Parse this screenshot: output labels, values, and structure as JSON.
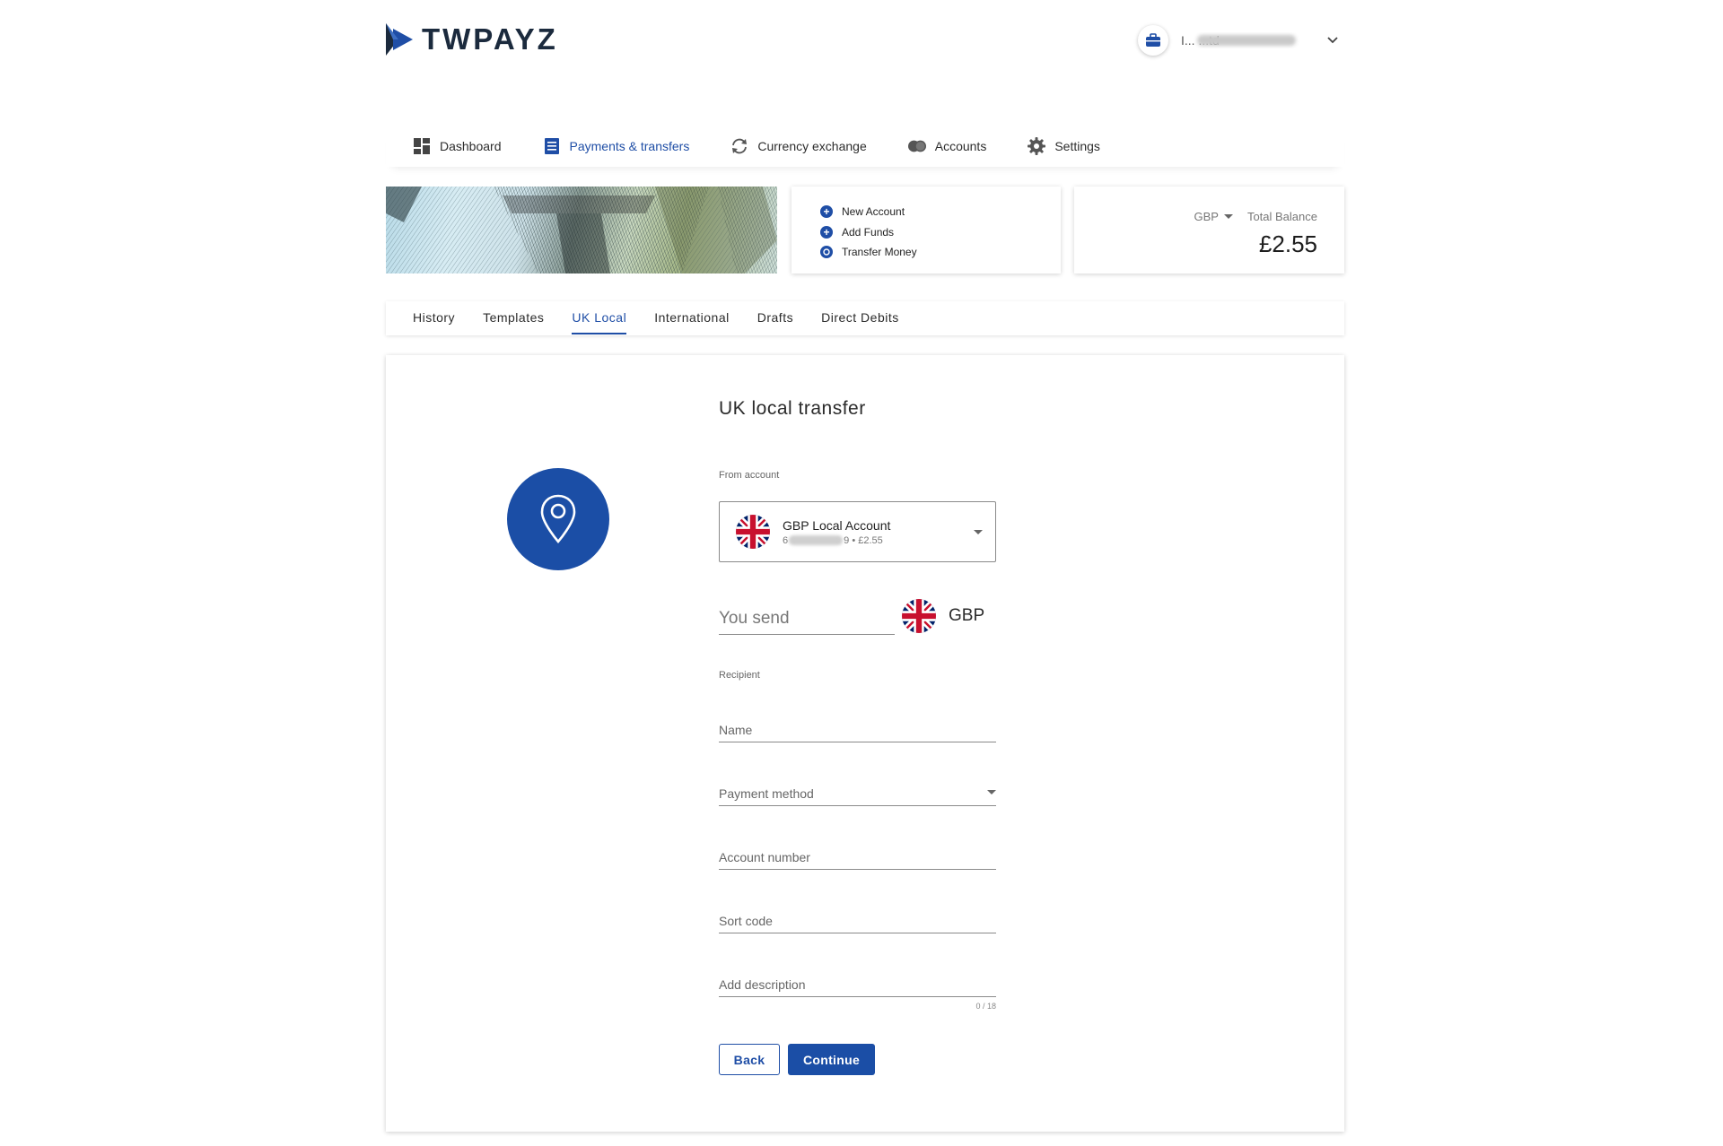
{
  "brand": {
    "name": "TWPAYZ",
    "accent": "#1b4ea6"
  },
  "user": {
    "name": "I... ...td",
    "avatar_icon": "briefcase-icon"
  },
  "nav": {
    "items": [
      {
        "label": "Dashboard",
        "icon": "dashboard-icon"
      },
      {
        "label": "Payments & transfers",
        "icon": "list-icon",
        "active": true
      },
      {
        "label": "Currency exchange",
        "icon": "exchange-icon"
      },
      {
        "label": "Accounts",
        "icon": "accounts-icon"
      },
      {
        "label": "Settings",
        "icon": "gear-icon"
      }
    ]
  },
  "quick_actions": {
    "new_account": "New Account",
    "add_funds": "Add Funds",
    "transfer_money": "Transfer Money"
  },
  "balance": {
    "currency": "GBP",
    "label": "Total Balance",
    "amount": "£2.55"
  },
  "tabs": {
    "history": "History",
    "templates": "Templates",
    "uk_local": "UK Local",
    "international": "International",
    "drafts": "Drafts",
    "direct_debits": "Direct Debits",
    "active": "UK Local"
  },
  "form": {
    "title": "UK local transfer",
    "from_account_label": "From account",
    "account": {
      "name": "GBP Local Account",
      "number_start": "6",
      "number_end": "9",
      "balance": "• £2.55"
    },
    "you_send_placeholder": "You send",
    "send_currency": "GBP",
    "recipient_label": "Recipient",
    "name_placeholder": "Name",
    "payment_method_placeholder": "Payment method",
    "account_number_placeholder": "Account number",
    "sort_code_placeholder": "Sort code",
    "description_placeholder": "Add description",
    "description_counter": "0 / 18",
    "back_label": "Back",
    "continue_label": "Continue"
  }
}
